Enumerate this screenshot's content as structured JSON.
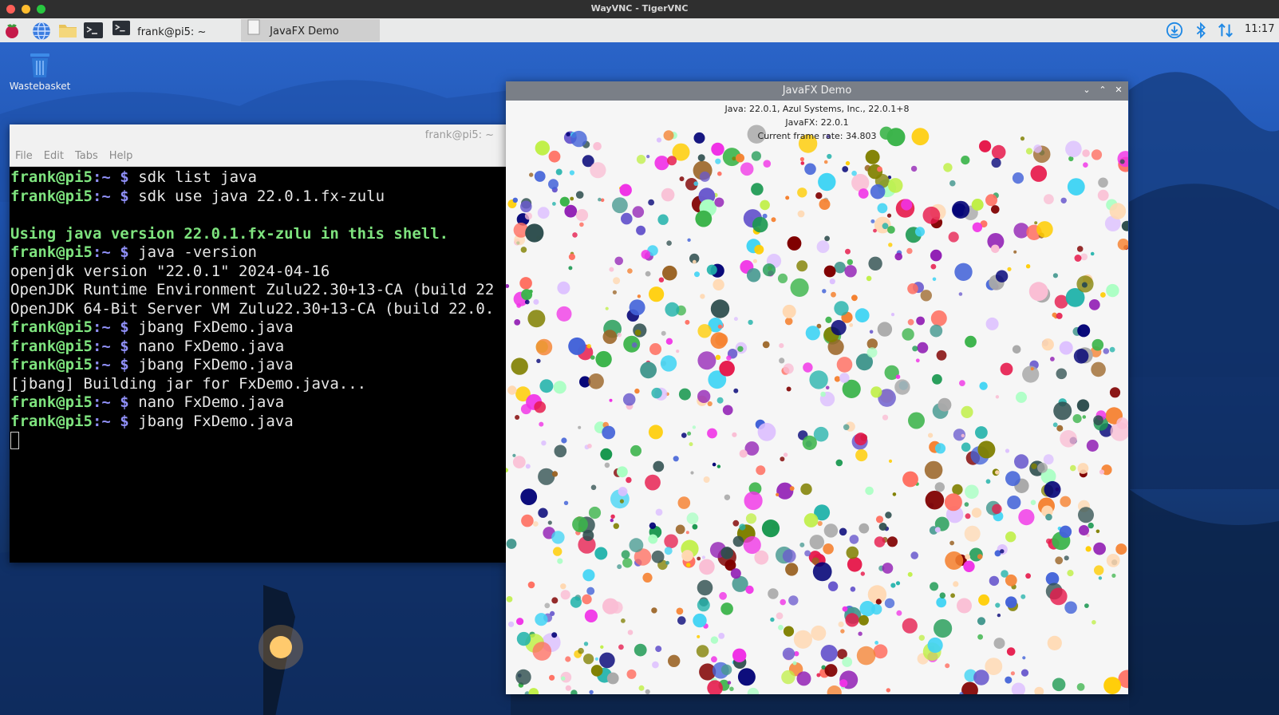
{
  "window": {
    "title": "WayVNC - TigerVNC"
  },
  "taskbar": {
    "tasks": [
      {
        "label": "frank@pi5: ~"
      },
      {
        "label": "JavaFX Demo"
      }
    ],
    "tray": {
      "clock": "11:17"
    }
  },
  "desktop": {
    "icons": [
      {
        "label": "Wastebasket"
      }
    ]
  },
  "terminal": {
    "title": "frank@pi5: ~",
    "menu": [
      "File",
      "Edit",
      "Tabs",
      "Help"
    ],
    "prompt_user": "frank@pi5",
    "prompt_path": ":~",
    "prompt_symbol": "$",
    "lines": [
      {
        "type": "cmd",
        "text": " sdk list java"
      },
      {
        "type": "cmd",
        "text": " sdk use java 22.0.1.fx-zulu"
      },
      {
        "type": "blank",
        "text": ""
      },
      {
        "type": "info",
        "text": "Using java version 22.0.1.fx-zulu in this shell."
      },
      {
        "type": "cmd",
        "text": " java -version"
      },
      {
        "type": "out",
        "text": "openjdk version \"22.0.1\" 2024-04-16"
      },
      {
        "type": "out",
        "text": "OpenJDK Runtime Environment Zulu22.30+13-CA (build 22"
      },
      {
        "type": "out",
        "text": "OpenJDK 64-Bit Server VM Zulu22.30+13-CA (build 22.0."
      },
      {
        "type": "cmd",
        "text": " jbang FxDemo.java"
      },
      {
        "type": "cmd",
        "text": " nano FxDemo.java"
      },
      {
        "type": "cmd",
        "text": " jbang FxDemo.java"
      },
      {
        "type": "out",
        "text": "[jbang] Building jar for FxDemo.java..."
      },
      {
        "type": "cmd",
        "text": " nano FxDemo.java"
      },
      {
        "type": "cmd",
        "text": " jbang FxDemo.java"
      }
    ]
  },
  "javafx": {
    "title": "JavaFX Demo",
    "java_info": "Java: 22.0.1, Azul Systems, Inc., 22.0.1+8",
    "javafx_info": "JavaFX: 22.0.1",
    "frame_rate": "Current frame rate: 34.803",
    "palette": [
      "#e6194b",
      "#3cb44b",
      "#4363d8",
      "#f58231",
      "#911eb4",
      "#42d4f4",
      "#f032e6",
      "#bfef45",
      "#fabed4",
      "#469990",
      "#dcbeff",
      "#9a6324",
      "#800000",
      "#aaffc3",
      "#808000",
      "#ffd8b1",
      "#000075",
      "#a9a9a9",
      "#2f4f4f",
      "#1a9850",
      "#ff6f61",
      "#6a5acd",
      "#20b2aa",
      "#ffcc00"
    ]
  },
  "colors": {
    "terminal_user": "#7ee37e",
    "terminal_prompt": "#8f8ff6",
    "taskbar_bg": "#e9eaea"
  },
  "icons": [
    "raspberry-menu-icon",
    "web-browser-icon",
    "file-manager-icon",
    "terminal-icon",
    "download-icon",
    "bluetooth-icon",
    "network-icon",
    "trash-icon"
  ]
}
